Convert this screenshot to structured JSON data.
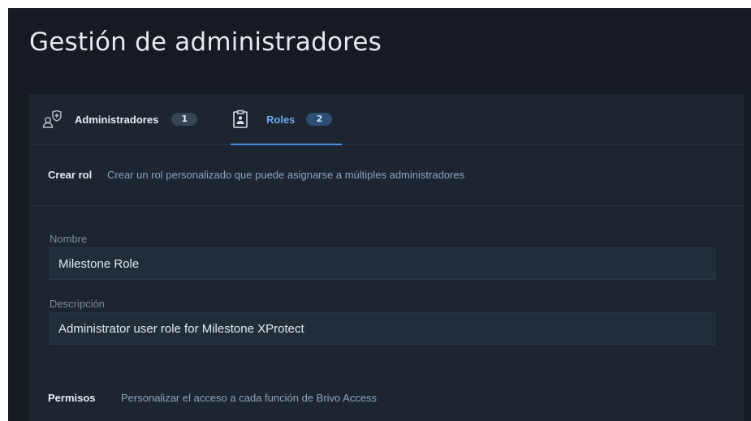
{
  "page": {
    "title": "Gestión de administradores"
  },
  "tabs": [
    {
      "label": "Administradores",
      "count": "1",
      "icon": "admin-shield-user-icon",
      "active": false
    },
    {
      "label": "Roles",
      "count": "2",
      "icon": "clipboard-user-icon",
      "active": true
    }
  ],
  "create_role": {
    "title": "Crear rol",
    "description": "Crear un rol personalizado que puede asignarse a múltiples administradores"
  },
  "form": {
    "name_label": "Nombre",
    "name_value": "Milestone Role",
    "description_label": "Descripción",
    "description_value": "Administrator user role for Milestone XProtect"
  },
  "permissions": {
    "title": "Permisos",
    "description": "Personalizar el acceso a cada función de Brivo Access"
  },
  "colors": {
    "background": "#161b22",
    "panel": "#1c2530",
    "accent": "#4a90e2",
    "input_background": "#222d3a"
  }
}
